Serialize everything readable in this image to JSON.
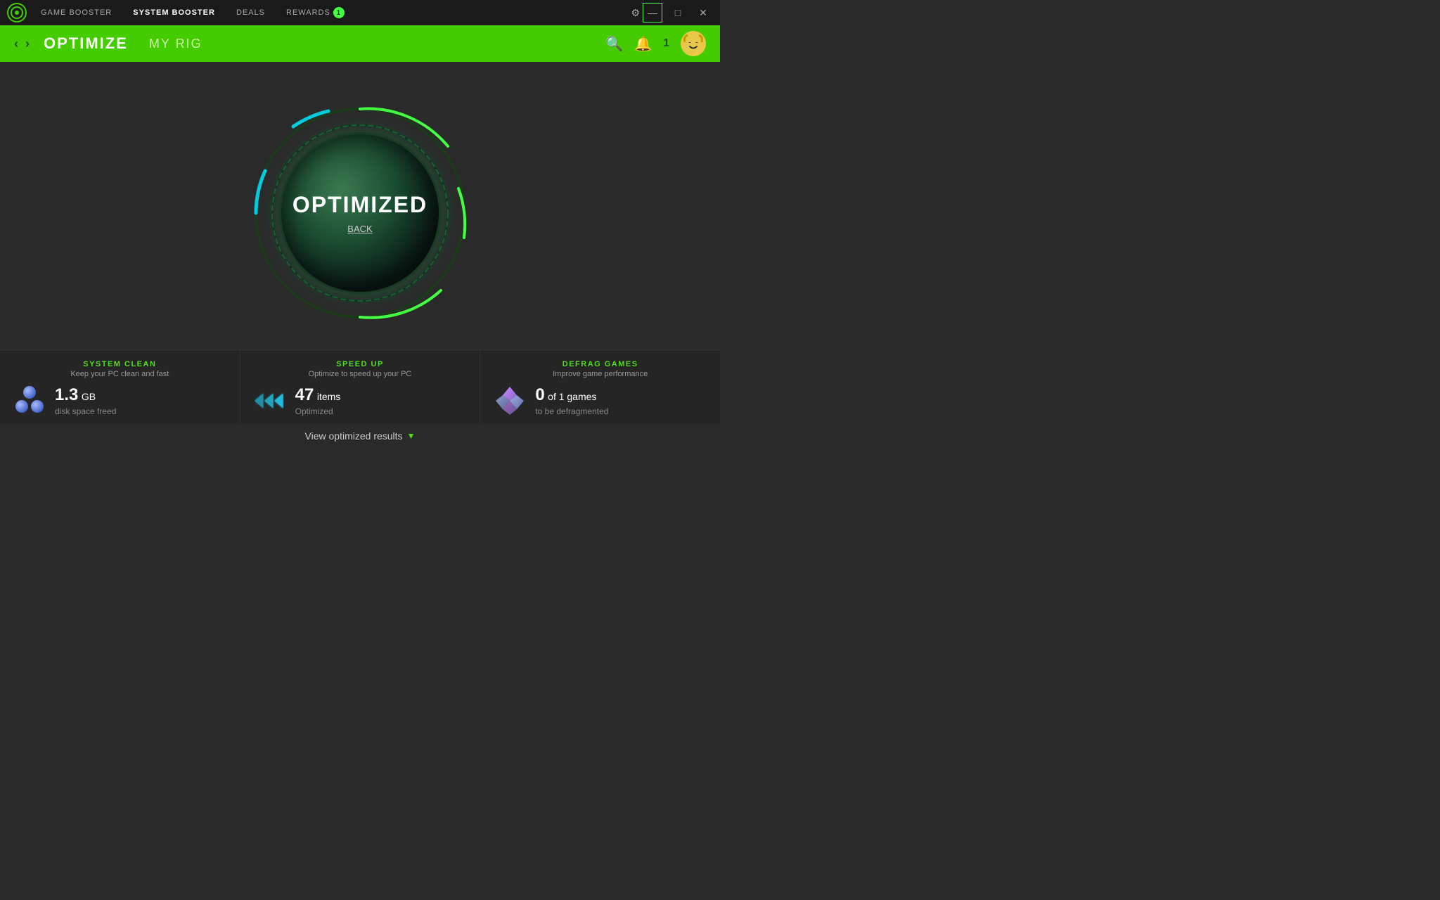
{
  "titlebar": {
    "nav": [
      {
        "id": "game-booster",
        "label": "GAME BOOSTER",
        "active": false
      },
      {
        "id": "system-booster",
        "label": "SYSTEM BOOSTER",
        "active": true
      },
      {
        "id": "deals",
        "label": "DEALS",
        "active": false
      },
      {
        "id": "rewards",
        "label": "REWARDS",
        "active": false,
        "badge": "1"
      }
    ],
    "gear_label": "⚙",
    "minimize_label": "—",
    "maximize_label": "□",
    "close_label": "✕"
  },
  "header": {
    "title": "OPTIMIZE",
    "subtitle": "MY RIG",
    "notif_count": "1",
    "avatar_emoji": "😊"
  },
  "main": {
    "status": "OPTIMIZED",
    "back_label": "BACK"
  },
  "stats": [
    {
      "id": "system-clean",
      "title": "SYSTEM CLEAN",
      "subtitle": "Keep your PC clean and fast",
      "value": "1.3",
      "unit": "GB",
      "detail": "disk space freed",
      "icon_type": "bubbles"
    },
    {
      "id": "speed-up",
      "title": "SPEED UP",
      "subtitle": "Optimize to speed up your PC",
      "value": "47",
      "unit": "items",
      "detail": "Optimized",
      "icon_type": "arrows"
    },
    {
      "id": "defrag-games",
      "title": "DEFRAG GAMES",
      "subtitle": "Improve game performance",
      "value": "0",
      "unit": " of 1 games",
      "detail": "to be defragmented",
      "icon_type": "diamond"
    }
  ],
  "view_results": {
    "label": "View optimized results",
    "chevron": "▼"
  }
}
